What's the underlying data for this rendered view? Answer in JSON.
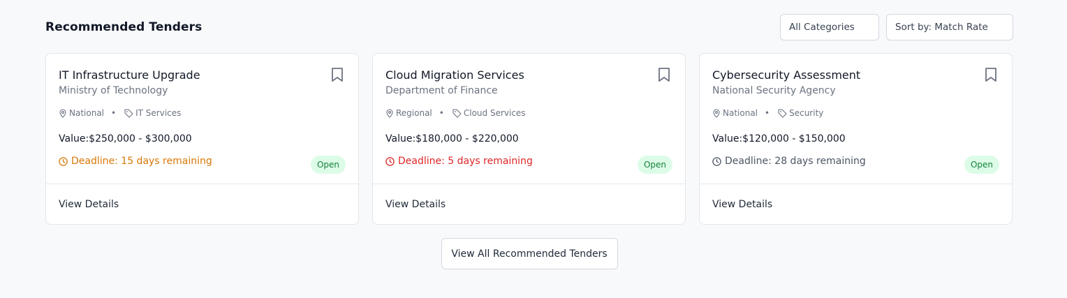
{
  "section": {
    "title": "Recommended Tenders",
    "category_filter": "All Categories",
    "sort_filter": "Sort by: Match Rate",
    "view_all_label": "View All Recommended Tenders"
  },
  "colors": {
    "accent_orange": "#d97706",
    "accent_red": "#dc2626",
    "status_green_bg": "#dcfce7",
    "status_green_text": "#15803d"
  },
  "cards": [
    {
      "title": "IT Infrastructure Upgrade",
      "organization": "Ministry of Technology",
      "location": "National",
      "category": "IT Services",
      "value": "Value:$250,000 - $300,000",
      "deadline": "Deadline: 15 days remaining",
      "deadline_urgency": "orange",
      "status": "Open",
      "link_label": "View Details"
    },
    {
      "title": "Cloud Migration Services",
      "organization": "Department of Finance",
      "location": "Regional",
      "category": "Cloud Services",
      "value": "Value:$180,000 - $220,000",
      "deadline": "Deadline: 5 days remaining",
      "deadline_urgency": "red",
      "status": "Open",
      "link_label": "View Details"
    },
    {
      "title": "Cybersecurity Assessment",
      "organization": "National Security Agency",
      "location": "National",
      "category": "Security",
      "value": "Value:$120,000 - $150,000",
      "deadline": "Deadline: 28 days remaining",
      "deadline_urgency": "gray",
      "status": "Open",
      "link_label": "View Details"
    }
  ]
}
